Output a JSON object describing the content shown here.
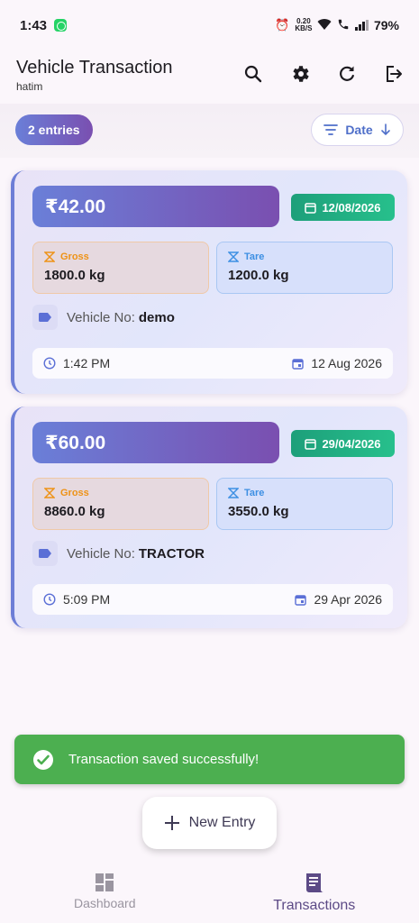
{
  "status_bar": {
    "time": "1:43",
    "net_speed_value": "0.20",
    "net_speed_unit": "KB/S",
    "battery": "79%"
  },
  "app_bar": {
    "title": "Vehicle Transaction",
    "subtitle": "hatim"
  },
  "filter": {
    "entries_label": "2 entries",
    "sort_label": "Date"
  },
  "transactions": [
    {
      "amount": "₹42.00",
      "date_badge": "12/08/2026",
      "gross_label": "Gross",
      "gross_value": "1800.0 kg",
      "tare_label": "Tare",
      "tare_value": "1200.0 kg",
      "vehicle_label": "Vehicle No:",
      "vehicle_no": "demo",
      "time": "1:42 PM",
      "date_long": "12 Aug 2026"
    },
    {
      "amount": "₹60.00",
      "date_badge": "29/04/2026",
      "gross_label": "Gross",
      "gross_value": "8860.0 kg",
      "tare_label": "Tare",
      "tare_value": "3550.0 kg",
      "vehicle_label": "Vehicle No:",
      "vehicle_no": "TRACTOR",
      "time": "5:09 PM",
      "date_long": "29 Apr 2026"
    }
  ],
  "snackbar": {
    "message": "Transaction saved successfully!"
  },
  "fab": {
    "label": "New Entry"
  },
  "bottom_nav": {
    "items": [
      {
        "label": "Dashboard",
        "icon": "dashboard-icon",
        "active": false
      },
      {
        "label": "Transactions",
        "icon": "receipt-icon",
        "active": true
      }
    ]
  },
  "colors": {
    "accent_gradient_start": "#6a7fd8",
    "accent_gradient_end": "#7a4fb0",
    "date_badge": "#1d9f7a",
    "gross": "#ee9216",
    "tare": "#3d8fe3",
    "snackbar": "#4caf50"
  }
}
